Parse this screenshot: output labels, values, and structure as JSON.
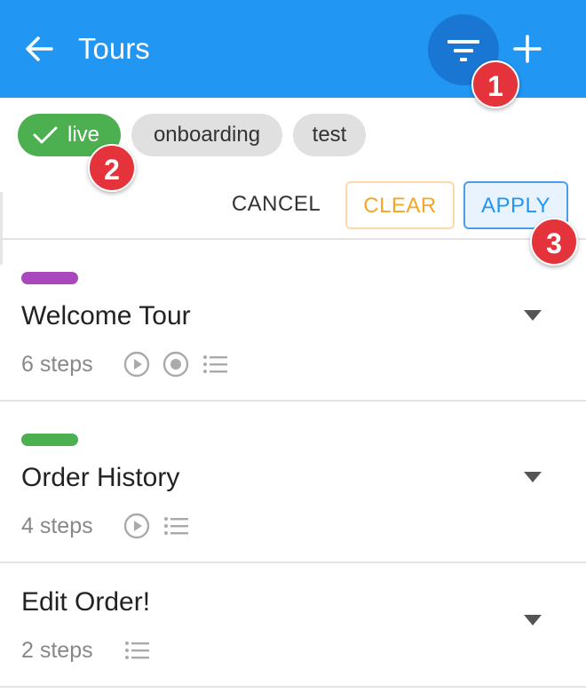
{
  "header": {
    "title": "Tours",
    "back_icon": "arrow-left-icon",
    "filter_icon": "filter-icon",
    "add_icon": "plus-icon",
    "background_color": "#2196f3",
    "filter_button_color": "#1976d2"
  },
  "markers": [
    "1",
    "2",
    "3"
  ],
  "filters": {
    "chips": [
      {
        "label": "live",
        "selected": true,
        "icon": "check-icon",
        "color": "#4caf50"
      },
      {
        "label": "onboarding",
        "selected": false
      },
      {
        "label": "test",
        "selected": false
      }
    ],
    "actions": {
      "cancel": "CANCEL",
      "clear": "CLEAR",
      "apply": "APPLY"
    },
    "colors": {
      "clear": "#f5a623",
      "apply": "#2196f3"
    }
  },
  "tours": [
    {
      "title": "Welcome Tour",
      "steps": "6 steps",
      "tag_color": "#ab47bc",
      "icons": [
        "play-circle-icon",
        "record-icon",
        "list-icon"
      ],
      "dropdown_icon": "caret-down-icon"
    },
    {
      "title": "Order History",
      "steps": "4 steps",
      "tag_color": "#4caf50",
      "icons": [
        "play-circle-icon",
        "list-icon"
      ],
      "dropdown_icon": "caret-down-icon"
    },
    {
      "title": "Edit Order!",
      "steps": "2 steps",
      "icons": [
        "list-icon"
      ],
      "dropdown_icon": "caret-down-icon"
    }
  ]
}
